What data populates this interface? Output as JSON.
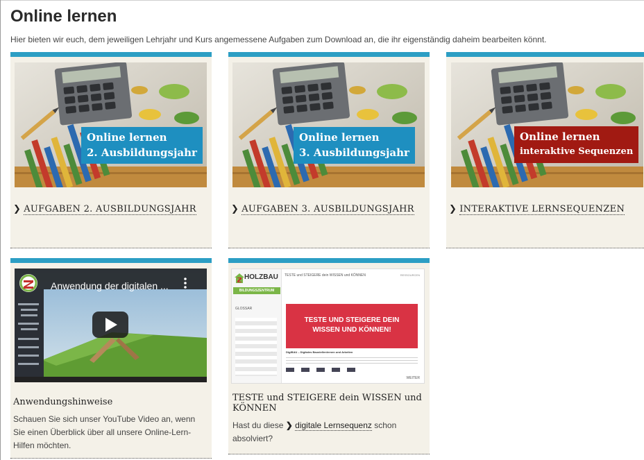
{
  "page": {
    "title": "Online lernen",
    "intro": "Hier bieten wir euch, dem jeweiligen Lehrjahr und Kurs angemessene Aufgaben zum Download an, die ihr eigenständig daheim bearbeiten könnt."
  },
  "colors": {
    "accent": "#2c9ec4",
    "card_bg": "#f4f1e8",
    "badge_blue": "#1e8fc0",
    "badge_red": "#a11a12",
    "digibau_red": "#d93344"
  },
  "cards": [
    {
      "badge_line1": "Online lernen",
      "badge_line2": "2. Ausbildungsjahr",
      "link": "AUFGABEN 2. AUSBILDUNGSJAHR"
    },
    {
      "badge_line1": "Online lernen",
      "badge_line2": "3. Ausbildungsjahr",
      "link": "AUFGABEN 3. AUSBILDUNGSJAHR"
    },
    {
      "badge_line1": "Online lernen",
      "badge_line2": "interaktive Sequenzen",
      "link": "INTERAKTIVE LERNSEQUENZEN"
    }
  ],
  "video": {
    "video_title": "Anwendung der digitalen ...",
    "title": "Anwendungshinweise",
    "desc": "Schauen Sie sich unser YouTube Video an, wenn Sie einen Überblick über all unsere Online-Lern-Hilfen möchten."
  },
  "teste": {
    "brand": "HOLZBAU",
    "brand_sub": "BILDUNGSZENTRUM",
    "topbar": "TESTE und STEIGERE dein WISSEN und KÖNNEN",
    "topbar_right": "RESSOURCEN",
    "glossar": "GLOSSAR",
    "hero": "TESTE UND STEIGERE DEIN WISSEN UND KÖNNEN!",
    "hero_line1": "TESTE UND STEIGERE DEIN",
    "hero_line2": "WISSEN UND KÖNNEN!",
    "caption": "DigiBAU – Digitales Baustellenlernen und Arbeiten",
    "weiter": "WEITER",
    "title": "TESTE und STEIGERE dein WISSEN und KÖNNEN",
    "desc_pre": "Hast du diese",
    "desc_link": "digitale Lernsequenz",
    "desc_post": "schon absolviert?"
  }
}
